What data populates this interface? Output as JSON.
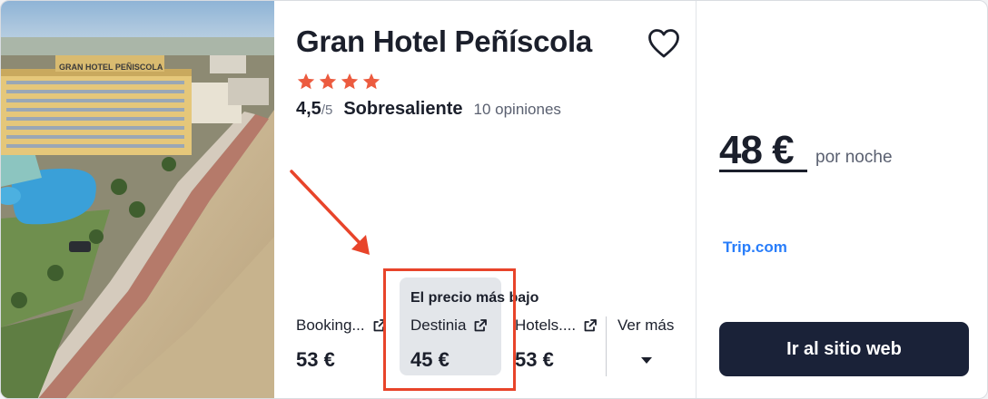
{
  "hotel": {
    "name": "Gran Hotel Peñíscola",
    "sign_text": "GRAN HOTEL PEÑISCOLA",
    "stars": 4,
    "rating_score": "4,5",
    "rating_scale": "/5",
    "rating_label": "Sobresaliente",
    "reviews": "10 opiniones"
  },
  "deals": {
    "lowest_label": "El precio más bajo",
    "items": [
      {
        "provider": "Booking...",
        "price": "53 €"
      },
      {
        "provider": "Destinia",
        "price": "45 €"
      },
      {
        "provider": "Hotels....",
        "price": "53 €"
      }
    ],
    "more_label": "Ver más"
  },
  "offer": {
    "price": "48 €",
    "unit": "por noche",
    "provider": "Trip.com",
    "cta": "Ir al sitio web"
  },
  "colors": {
    "star": "#ec5b3f",
    "annotation": "#e8442a",
    "cta_bg": "#1a2238",
    "provider_link": "#287dfa"
  }
}
